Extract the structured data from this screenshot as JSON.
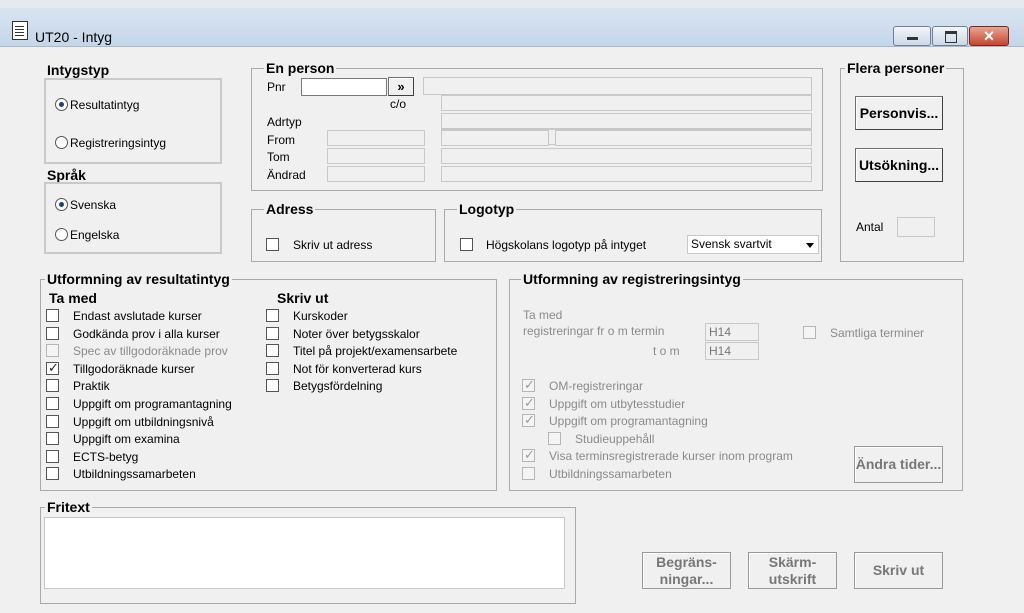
{
  "window": {
    "title": "UT20 - Intyg"
  },
  "intygstyp": {
    "legend": "Intygstyp",
    "options": [
      {
        "label": "Resultatintyg",
        "checked": true
      },
      {
        "label": "Registreringsintyg",
        "checked": false
      }
    ]
  },
  "sprak": {
    "legend": "Språk",
    "options": [
      {
        "label": "Svenska",
        "checked": true
      },
      {
        "label": "Engelska",
        "checked": false
      }
    ]
  },
  "en_person": {
    "legend": "En person",
    "pnr_label": "Pnr",
    "pnr_value": "",
    "go_button": "»",
    "co_label": "c/o",
    "adrtyp_label": "Adrtyp",
    "from_label": "From",
    "tom_label": "Tom",
    "andrad_label": "Ändrad"
  },
  "flera_personer": {
    "legend": "Flera personer",
    "personvis_button": "Personvis...",
    "utsokning_button": "Utsökning...",
    "antal_label": "Antal",
    "antal_value": ""
  },
  "adress": {
    "legend": "Adress",
    "skriv_ut_adress": "Skriv ut adress"
  },
  "logotyp": {
    "legend": "Logotyp",
    "checkbox_label": "Högskolans logotyp på intyget",
    "select_value": "Svensk svartvit"
  },
  "utformning_resultat": {
    "legend": "Utformning av resultatintyg",
    "ta_med_header": "Ta med",
    "ta_med": [
      {
        "label": "Endast avslutade kurser",
        "checked": false,
        "disabled": false
      },
      {
        "label": "Godkända prov i alla kurser",
        "checked": false,
        "disabled": false
      },
      {
        "label": "Spec av tillgodoräknade prov",
        "checked": false,
        "disabled": true
      },
      {
        "label": "Tillgodoräknade kurser",
        "checked": true,
        "disabled": false
      },
      {
        "label": "Praktik",
        "checked": false,
        "disabled": false
      },
      {
        "label": "Uppgift om programantagning",
        "checked": false,
        "disabled": false
      },
      {
        "label": "Uppgift om utbildningsnivå",
        "checked": false,
        "disabled": false
      },
      {
        "label": "Uppgift om examina",
        "checked": false,
        "disabled": false
      },
      {
        "label": "ECTS-betyg",
        "checked": false,
        "disabled": false
      },
      {
        "label": "Utbildningssamarbeten",
        "checked": false,
        "disabled": false
      }
    ],
    "skriv_ut_header": "Skriv ut",
    "skriv_ut": [
      {
        "label": "Kurskoder",
        "checked": false
      },
      {
        "label": "Noter över betygsskalor",
        "checked": false
      },
      {
        "label": "Titel på projekt/examensarbete",
        "checked": false
      },
      {
        "label": "Not för konverterad kurs",
        "checked": false
      },
      {
        "label": "Betygsfördelning",
        "checked": false
      }
    ]
  },
  "utformning_registrering": {
    "legend": "Utformning av registreringsintyg",
    "ta_med_label": "Ta med",
    "from_termin_label": "registreringar fr o m termin",
    "from_termin_value": "H14",
    "tom_label": "t o m",
    "tom_value": "H14",
    "samtliga_terminer": "Samtliga terminer",
    "options": [
      {
        "label": "OM-registreringar",
        "checked": true
      },
      {
        "label": "Uppgift om utbytesstudier",
        "checked": true
      },
      {
        "label": "Uppgift om programantagning",
        "checked": true
      },
      {
        "label": "Studieuppehåll",
        "checked": false
      },
      {
        "label": "Visa terminsregistrerade kurser inom program",
        "checked": true
      },
      {
        "label": "Utbildningssamarbeten",
        "checked": false
      }
    ],
    "andra_tider_button": "Ändra tider..."
  },
  "fritext": {
    "legend": "Fritext",
    "value": ""
  },
  "bottom_buttons": {
    "begransningar": "Begräns- ningar...",
    "skarmutskrift": "Skärm- utskrift",
    "skriv_ut": "Skriv ut"
  }
}
